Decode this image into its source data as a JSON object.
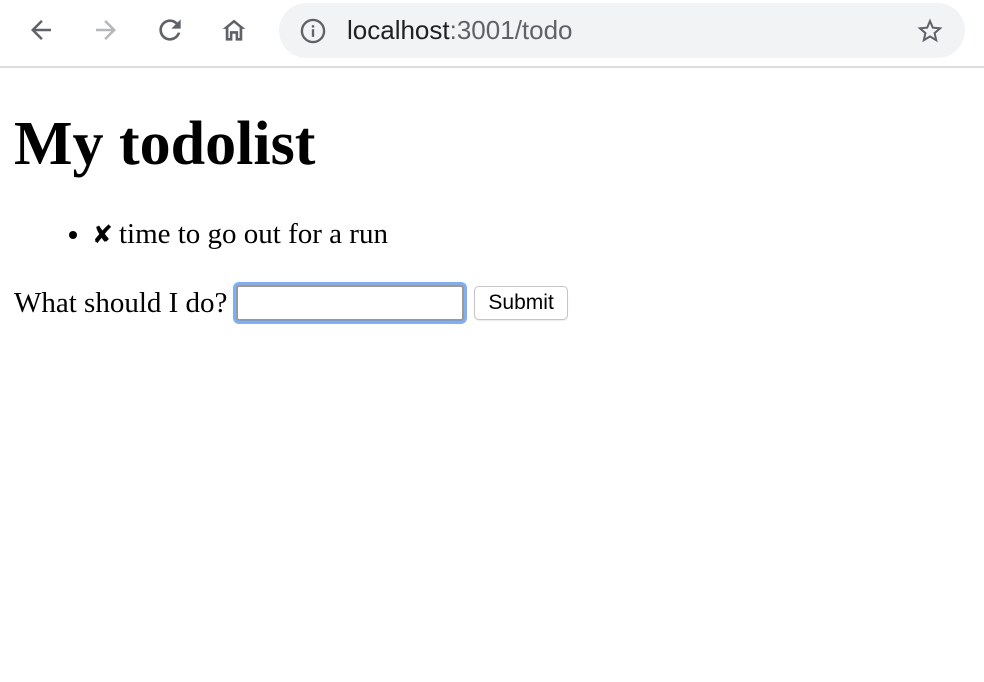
{
  "browser": {
    "url_host": "localhost",
    "url_rest": ":3001/todo",
    "icons": {
      "back": "arrow-left",
      "forward": "arrow-right",
      "reload": "reload",
      "home": "home",
      "site_info": "info-circle",
      "bookmark": "star-outline"
    },
    "colors": {
      "icon_active": "#5f6368",
      "icon_disabled": "#b5b7ba",
      "omnibox_bg": "#f1f3f4"
    }
  },
  "page": {
    "title": "My todolist",
    "todos": [
      {
        "mark": "✘",
        "text": "time to go out for a run"
      }
    ],
    "form": {
      "label": "What should I do?",
      "input_value": "",
      "submit_label": "Submit"
    },
    "colors": {
      "input_focus_ring": "#7eaef5"
    }
  }
}
